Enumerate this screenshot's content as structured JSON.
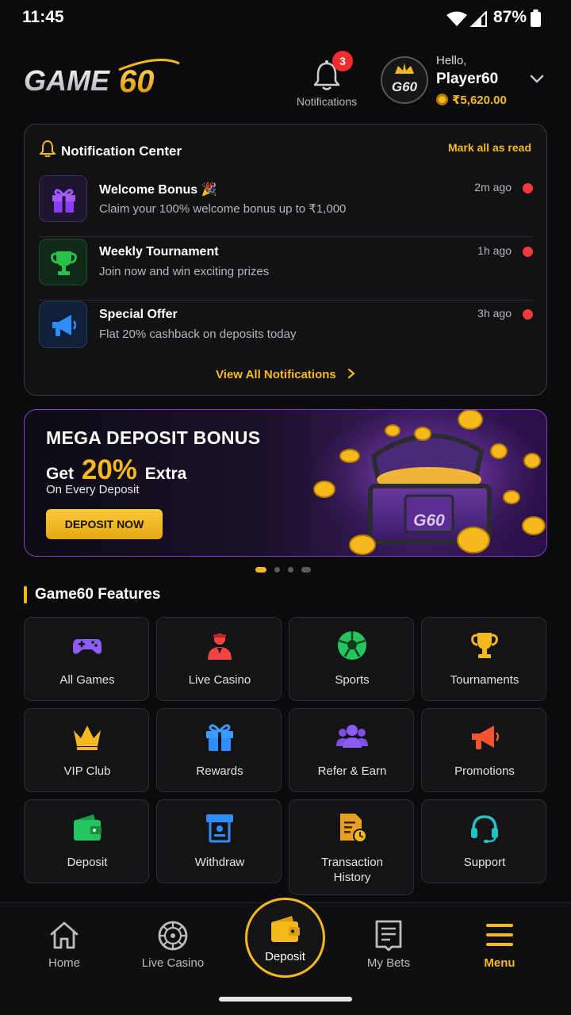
{
  "status_bar": {
    "time": "11:45",
    "battery": "87%"
  },
  "header": {
    "logo_text": "GAME60",
    "notifications_label": "Notifications",
    "notifications_count": "3",
    "avatar_text": "G60",
    "greeting": "Hello,",
    "player_name": "Player60",
    "balance": "₹5,620.00"
  },
  "notification_center": {
    "title": "Notification Center",
    "mark_all": "Mark all as read",
    "items": [
      {
        "title": "Welcome Bonus 🎉",
        "desc": "Claim your 100% welcome bonus up to ₹1,000",
        "time": "2m ago",
        "icon": "gift-icon"
      },
      {
        "title": "Weekly Tournament",
        "desc": "Join now and win exciting prizes",
        "time": "1h ago",
        "icon": "trophy-icon"
      },
      {
        "title": "Special Offer",
        "desc": "Flat 20% cashback on deposits today",
        "time": "3h ago",
        "icon": "megaphone-icon"
      }
    ],
    "view_all": "View All Notifications"
  },
  "banner": {
    "title": "MEGA DEPOSIT BONUS",
    "get": "Get",
    "percent": "20%",
    "extra": "Extra",
    "subtitle": "On Every Deposit",
    "button": "DEPOSIT NOW",
    "chest_text": "G60",
    "active_slide": 1,
    "slide_count": 4
  },
  "features": {
    "title": "Game60 Features",
    "items": [
      {
        "label": "All Games",
        "icon": "gamepad-icon"
      },
      {
        "label": "Live Casino",
        "icon": "dealer-icon"
      },
      {
        "label": "Sports",
        "icon": "football-icon"
      },
      {
        "label": "Tournaments",
        "icon": "trophy-icon"
      },
      {
        "label": "VIP Club",
        "icon": "crown-icon"
      },
      {
        "label": "Rewards",
        "icon": "gift-icon"
      },
      {
        "label": "Refer & Earn",
        "icon": "users-icon"
      },
      {
        "label": "Promotions",
        "icon": "megaphone-icon"
      },
      {
        "label": "Deposit",
        "icon": "wallet-icon"
      },
      {
        "label": "Withdraw",
        "icon": "atm-icon"
      },
      {
        "label": "Transaction History",
        "icon": "document-clock-icon"
      },
      {
        "label": "Support",
        "icon": "headset-icon"
      }
    ]
  },
  "bottom_nav": {
    "home": "Home",
    "live_casino": "Live Casino",
    "deposit": "Deposit",
    "my_bets": "My Bets",
    "menu": "Menu"
  },
  "colors": {
    "accent": "#f5b91d",
    "background": "#0b0b0d",
    "badge": "#ef2d2d",
    "banner_border": "#7f3fc8"
  }
}
